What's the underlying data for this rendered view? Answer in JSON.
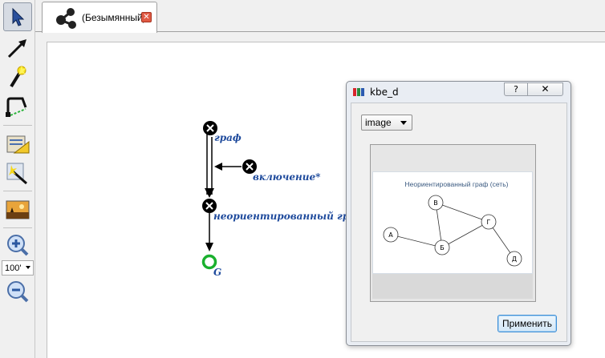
{
  "toolbar": {
    "items": [
      {
        "name": "select-tool",
        "icon": "cursor-arrow-icon",
        "selected": true
      },
      {
        "name": "edge-tool",
        "icon": "arrow-icon",
        "selected": false
      },
      {
        "name": "magic-tool",
        "icon": "magic-wand-icon",
        "selected": false
      },
      {
        "name": "connector-tool",
        "icon": "connector-icon",
        "selected": false
      },
      {
        "name": "layout-tool",
        "icon": "layout-icon",
        "selected": false
      },
      {
        "name": "auto-tool",
        "icon": "wand-grid-icon",
        "selected": false
      },
      {
        "name": "image-tool",
        "icon": "image-icon",
        "selected": false
      },
      {
        "name": "zoom-in",
        "icon": "zoom-in-icon",
        "selected": false
      },
      {
        "name": "zoom-out",
        "icon": "zoom-out-icon",
        "selected": false
      }
    ],
    "zoom_value": "100'"
  },
  "tab": {
    "title": "(Безымянный)",
    "close_symbol": "✕"
  },
  "graph": {
    "nodes": [
      {
        "id": "n1",
        "label": "граф"
      },
      {
        "id": "n2",
        "label": "включение*"
      },
      {
        "id": "n3",
        "label": "неориентированный граф"
      },
      {
        "id": "n4",
        "label": "G"
      }
    ],
    "colors": {
      "label": "#1e4a9c",
      "node": "#000000",
      "goal_node": "#1ab02e"
    }
  },
  "dialog": {
    "title": "kbe_d",
    "help_symbol": "?",
    "close_symbol": "✕",
    "mode_select": {
      "value": "image"
    },
    "preview": {
      "title": "Неориентированный граф (сеть)",
      "vertices": [
        "А",
        "Б",
        "В",
        "Г",
        "Д"
      ],
      "edges": [
        [
          "А",
          "Б"
        ],
        [
          "Б",
          "В"
        ],
        [
          "Б",
          "Г"
        ],
        [
          "В",
          "Г"
        ],
        [
          "Г",
          "Д"
        ]
      ]
    },
    "apply_label": "Применить"
  }
}
